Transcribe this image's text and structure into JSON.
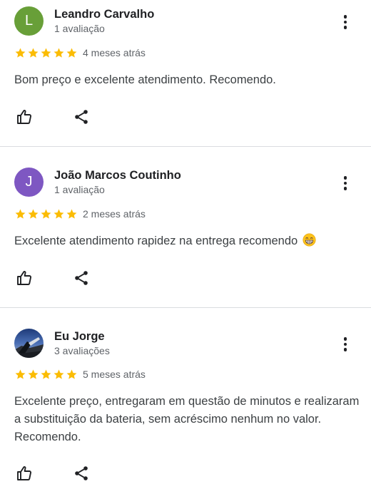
{
  "reviews": [
    {
      "avatar_letter": "L",
      "avatar_color": "#689f38",
      "name": "Leandro Carvalho",
      "review_count": "1 avaliação",
      "rating": 5,
      "time": "4 meses atrás",
      "text": "Bom preço e excelente atendimento. Recomendo.",
      "emoji": ""
    },
    {
      "avatar_letter": "J",
      "avatar_color": "#7e57c2",
      "name": "João Marcos Coutinho",
      "review_count": "1 avaliação",
      "rating": 5,
      "time": "2 meses atrás",
      "text": "Excelente atendimento rapidez na entrega recomendo",
      "emoji": "grinning-face-emoji"
    },
    {
      "avatar_letter": "",
      "avatar_color": "#37474f",
      "name": "Eu Jorge",
      "review_count": "3 avaliações",
      "rating": 5,
      "time": "5 meses atrás",
      "text": "Excelente preço, entregaram em questão de minutos e realizaram a substituição da bateria, sem acréscimo nenhum no valor. Recomendo.",
      "emoji": ""
    }
  ],
  "colors": {
    "star": "#fbbc04",
    "divider": "#dadce0",
    "secondary_text": "#5f6368"
  },
  "icons": [
    "more-vert-icon",
    "star-icon",
    "thumbs-up-icon",
    "share-icon"
  ]
}
